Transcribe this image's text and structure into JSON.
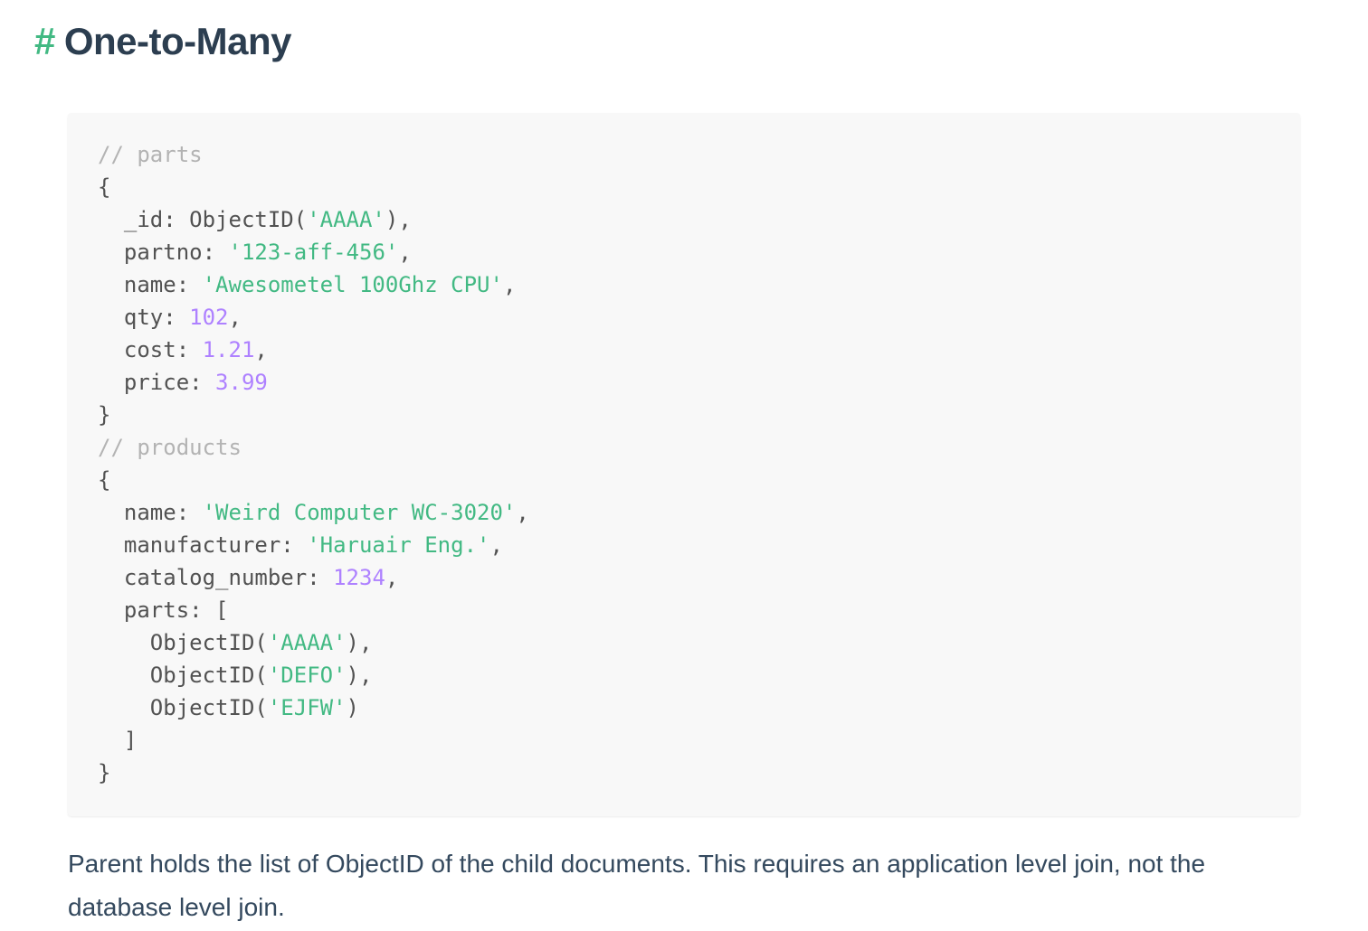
{
  "heading": {
    "hash": "#",
    "title": "One-to-Many"
  },
  "colors": {
    "accent": "#42b983",
    "comment": "#b3b3b3",
    "string": "#42b983",
    "number": "#ae81ff",
    "text": "#34495e",
    "code_bg": "#f8f8f8"
  },
  "code": {
    "lines": [
      [
        {
          "t": "comment",
          "v": "// parts"
        }
      ],
      [
        {
          "t": "plain",
          "v": "{"
        }
      ],
      [
        {
          "t": "plain",
          "v": "  _id: ObjectID("
        },
        {
          "t": "string",
          "v": "'AAAA'"
        },
        {
          "t": "plain",
          "v": "),"
        }
      ],
      [
        {
          "t": "plain",
          "v": "  partno: "
        },
        {
          "t": "string",
          "v": "'123-aff-456'"
        },
        {
          "t": "plain",
          "v": ","
        }
      ],
      [
        {
          "t": "plain",
          "v": "  name: "
        },
        {
          "t": "string",
          "v": "'Awesometel 100Ghz CPU'"
        },
        {
          "t": "plain",
          "v": ","
        }
      ],
      [
        {
          "t": "plain",
          "v": "  qty: "
        },
        {
          "t": "number",
          "v": "102"
        },
        {
          "t": "plain",
          "v": ","
        }
      ],
      [
        {
          "t": "plain",
          "v": "  cost: "
        },
        {
          "t": "number",
          "v": "1.21"
        },
        {
          "t": "plain",
          "v": ","
        }
      ],
      [
        {
          "t": "plain",
          "v": "  price: "
        },
        {
          "t": "number",
          "v": "3.99"
        }
      ],
      [
        {
          "t": "plain",
          "v": "}"
        }
      ],
      [
        {
          "t": "comment",
          "v": "// products"
        }
      ],
      [
        {
          "t": "plain",
          "v": "{"
        }
      ],
      [
        {
          "t": "plain",
          "v": "  name: "
        },
        {
          "t": "string",
          "v": "'Weird Computer WC-3020'"
        },
        {
          "t": "plain",
          "v": ","
        }
      ],
      [
        {
          "t": "plain",
          "v": "  manufacturer: "
        },
        {
          "t": "string",
          "v": "'Haruair Eng.'"
        },
        {
          "t": "plain",
          "v": ","
        }
      ],
      [
        {
          "t": "plain",
          "v": "  catalog_number: "
        },
        {
          "t": "number",
          "v": "1234"
        },
        {
          "t": "plain",
          "v": ","
        }
      ],
      [
        {
          "t": "plain",
          "v": "  parts: ["
        }
      ],
      [
        {
          "t": "plain",
          "v": "    ObjectID("
        },
        {
          "t": "string",
          "v": "'AAAA'"
        },
        {
          "t": "plain",
          "v": "),"
        }
      ],
      [
        {
          "t": "plain",
          "v": "    ObjectID("
        },
        {
          "t": "string",
          "v": "'DEFO'"
        },
        {
          "t": "plain",
          "v": "),"
        }
      ],
      [
        {
          "t": "plain",
          "v": "    ObjectID("
        },
        {
          "t": "string",
          "v": "'EJFW'"
        },
        {
          "t": "plain",
          "v": ")"
        }
      ],
      [
        {
          "t": "plain",
          "v": "  ]"
        }
      ],
      [
        {
          "t": "plain",
          "v": "}"
        }
      ]
    ]
  },
  "paragraph": {
    "text": "Parent holds the list of ObjectID of the child documents. This requires an application level join, not the database level join."
  }
}
